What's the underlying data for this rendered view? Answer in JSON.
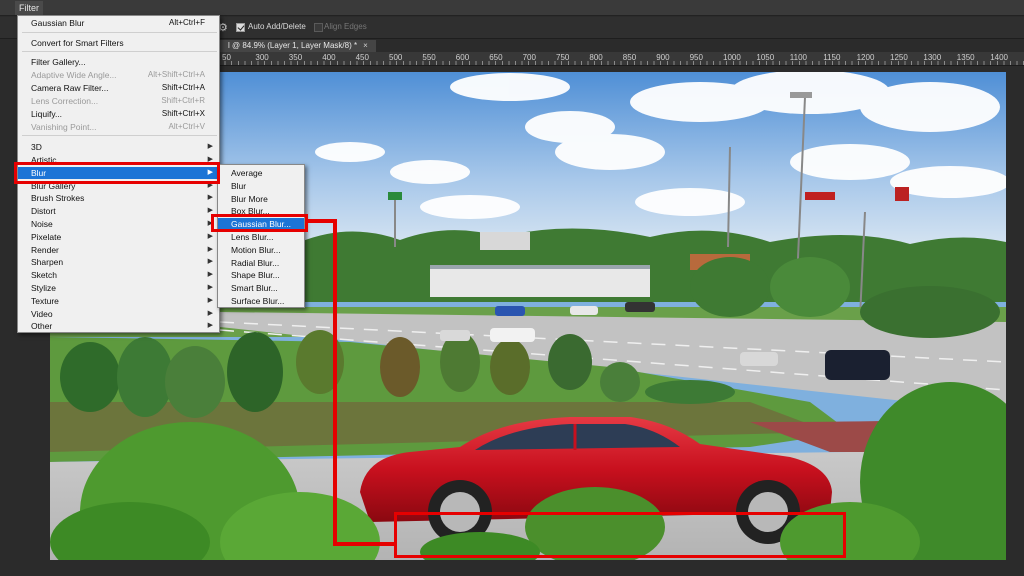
{
  "menubar": {
    "filter_label": "Filter"
  },
  "options_bar": {
    "auto_add_delete": "Auto Add/Delete",
    "align_edges": "Align Edges"
  },
  "document_tab": {
    "title": "l @ 84.9% (Layer 1, Layer Mask/8) *",
    "close": "×"
  },
  "ruler": {
    "labels": [
      "50",
      "300",
      "350",
      "400",
      "450",
      "500",
      "550",
      "600",
      "650",
      "700",
      "750",
      "800",
      "850",
      "900",
      "950",
      "1000",
      "1050",
      "1100",
      "1150",
      "1200",
      "1250",
      "1300",
      "1350",
      "1400"
    ]
  },
  "filter_menu": {
    "items": [
      {
        "label": "Gaussian Blur",
        "shortcut": "Alt+Ctrl+F",
        "enabled": true
      },
      {
        "label": "Convert for Smart Filters",
        "shortcut": "",
        "enabled": true
      },
      {
        "label": "Filter Gallery...",
        "shortcut": "",
        "enabled": true
      },
      {
        "label": "Adaptive Wide Angle...",
        "shortcut": "Alt+Shift+Ctrl+A",
        "enabled": false
      },
      {
        "label": "Camera Raw Filter...",
        "shortcut": "Shift+Ctrl+A",
        "enabled": true
      },
      {
        "label": "Lens Correction...",
        "shortcut": "Shift+Ctrl+R",
        "enabled": false
      },
      {
        "label": "Liquify...",
        "shortcut": "Shift+Ctrl+X",
        "enabled": true
      },
      {
        "label": "Vanishing Point...",
        "shortcut": "Alt+Ctrl+V",
        "enabled": false
      },
      {
        "label": "3D",
        "submenu": true,
        "enabled": true
      },
      {
        "label": "Artistic",
        "submenu": true,
        "enabled": true
      },
      {
        "label": "Blur",
        "submenu": true,
        "enabled": true,
        "highlighted": true
      },
      {
        "label": "Blur Gallery",
        "submenu": true,
        "enabled": true
      },
      {
        "label": "Brush Strokes",
        "submenu": true,
        "enabled": true
      },
      {
        "label": "Distort",
        "submenu": true,
        "enabled": true
      },
      {
        "label": "Noise",
        "submenu": true,
        "enabled": true
      },
      {
        "label": "Pixelate",
        "submenu": true,
        "enabled": true
      },
      {
        "label": "Render",
        "submenu": true,
        "enabled": true
      },
      {
        "label": "Sharpen",
        "submenu": true,
        "enabled": true
      },
      {
        "label": "Sketch",
        "submenu": true,
        "enabled": true
      },
      {
        "label": "Stylize",
        "submenu": true,
        "enabled": true
      },
      {
        "label": "Texture",
        "submenu": true,
        "enabled": true
      },
      {
        "label": "Video",
        "submenu": true,
        "enabled": true
      },
      {
        "label": "Other",
        "submenu": true,
        "enabled": true
      }
    ]
  },
  "blur_submenu": {
    "items": [
      {
        "label": "Average"
      },
      {
        "label": "Blur"
      },
      {
        "label": "Blur More"
      },
      {
        "label": "Box Blur..."
      },
      {
        "label": "Gaussian Blur...",
        "highlighted": true
      },
      {
        "label": "Lens Blur..."
      },
      {
        "label": "Motion Blur..."
      },
      {
        "label": "Radial Blur..."
      },
      {
        "label": "Shape Blur..."
      },
      {
        "label": "Smart Blur..."
      },
      {
        "label": "Surface Blur..."
      }
    ]
  },
  "colors": {
    "highlight": "#1c74d6",
    "annotation": "#e60000",
    "car": "#c8101e",
    "sky": "#7fb0de"
  },
  "scene": {
    "signs": [
      "",
      ""
    ]
  }
}
